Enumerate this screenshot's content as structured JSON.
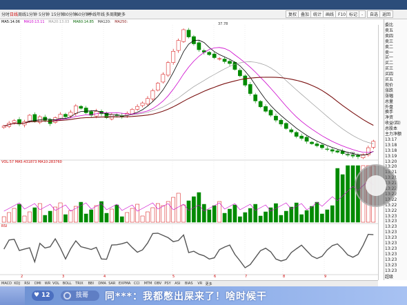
{
  "toptabs": {
    "items": [
      "分时",
      "日线",
      "周线",
      "1分钟",
      "5分钟",
      "15分钟",
      "30分钟",
      "60分钟",
      "季线",
      "年线",
      "多周期",
      "更多"
    ],
    "active_index": 1,
    "right_buttons": [
      "复权",
      "叠加",
      "统计",
      "画线",
      "F10",
      "标记",
      "-",
      "自选",
      "返回"
    ]
  },
  "legend": {
    "items": [
      {
        "text": "MA5:14.06",
        "color": "#000000"
      },
      {
        "text": "MA10:13.11",
        "color": "#cc00cc"
      },
      {
        "text": "MA20:13.03",
        "color": "#999999"
      },
      {
        "text": "MA60:14.85",
        "color": "#006600"
      },
      {
        "text": "MA120:",
        "color": "#333333"
      },
      {
        "text": "MA250:",
        "color": "#8b1a1a"
      }
    ]
  },
  "price_markers": {
    "high": "37.78",
    "low": "11.99"
  },
  "quote_column": {
    "rows": [
      "委比",
      "卖五",
      "卖四",
      "卖三",
      "卖二",
      "卖一",
      "买一",
      "买二",
      "买三",
      "买四",
      "买五",
      "现价",
      "涨跌",
      "涨幅",
      "总量",
      "外盘",
      "换手",
      "净资",
      "收益(四)",
      "总股本",
      "主力净额",
      "13:17",
      "13:18",
      "13:18",
      "13:19",
      "13:20",
      "13:20",
      "13:21",
      "13:21",
      "13:21",
      "13:22",
      "13:22",
      "13:22",
      "13:22",
      "13:22",
      "13:23",
      "13:23",
      "13:23",
      "13:23",
      "13:23",
      "13:23",
      "13:23",
      "13:23",
      "13:23",
      "13:23",
      "13:23"
    ],
    "footer": "超级"
  },
  "xaxis": {
    "labels": [
      "2",
      "3",
      "4",
      "5",
      "6",
      "7",
      "8",
      "9"
    ]
  },
  "volume_legend": {
    "text": "VOL:57 MA5:431873 MA10:283760"
  },
  "osc_legend": {
    "text": "RSI"
  },
  "indicator_tabs": [
    "MACD",
    "KDJ",
    "RSI",
    "DMI",
    "WR",
    "VOL",
    "BOLL",
    "TRIX",
    "BBI",
    "DMA",
    "SAR",
    "EXPMA",
    "CCI",
    "MTM",
    "OBV",
    "PSY",
    "ASI",
    "BIAS",
    "VR",
    "更多"
  ],
  "stream": {
    "count": "12",
    "badge": "技哥",
    "message": "同***：我都憋出屎来了！啥时候干"
  },
  "chart_data": {
    "type": "candlestick",
    "title": "",
    "price_range": [
      11.99,
      37.78
    ],
    "notes": "Daily candlestick chart with MA lines, volume bars and an oscillator sub-panel",
    "closes": [
      18.2,
      18.8,
      19.3,
      18.6,
      19.1,
      20.4,
      19.2,
      20.1,
      19.4,
      18.7,
      19.9,
      20.6,
      20.1,
      21.0,
      22.3,
      21.8,
      20.9,
      20.4,
      21.2,
      20.7,
      19.9,
      20.5,
      20.3,
      20.1,
      20.8,
      21.6,
      22.2,
      22.9,
      23.8,
      25.4,
      26.9,
      28.7,
      31.1,
      33.4,
      35.6,
      37.78,
      36.3,
      34.9,
      33.7,
      33.2,
      32.7,
      32.1,
      31.9,
      31.3,
      30.9,
      29.7,
      28.4,
      26.5,
      24.8,
      23.3,
      22.1,
      21.2,
      20.4,
      19.4,
      18.6,
      17.7,
      17.0,
      16.1,
      15.7,
      15.1,
      14.6,
      14.2,
      13.8,
      13.5,
      13.1,
      12.9,
      12.6,
      12.3,
      12.1,
      11.99,
      12.4,
      13.8,
      15.1
    ]
  }
}
